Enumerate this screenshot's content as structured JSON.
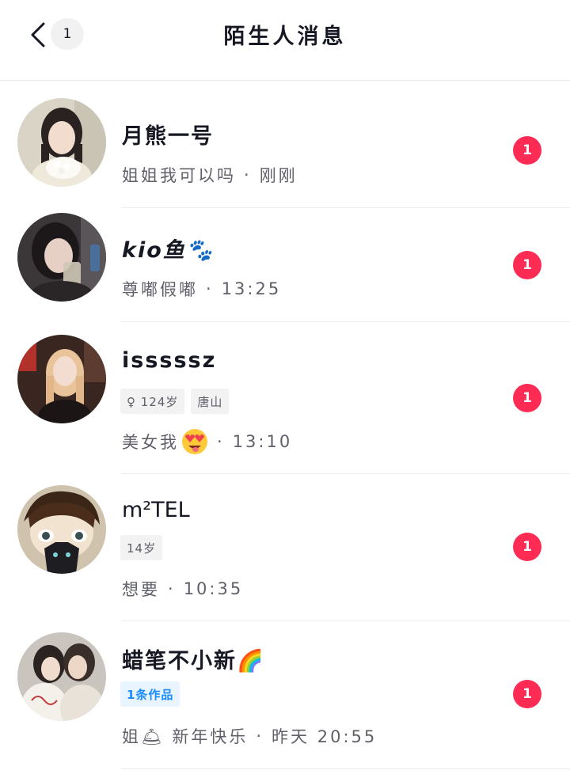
{
  "header": {
    "title": "陌生人消息",
    "unread_count": "1"
  },
  "messages": [
    {
      "name": "月熊一号",
      "preview": "姐姐我可以吗",
      "time": "刚刚",
      "badge": "1"
    },
    {
      "name": "kio鱼🐾",
      "preview": "尊嘟假嘟",
      "time": "13:25",
      "badge": "1"
    },
    {
      "name": "isssssz",
      "tags": [
        "♀ 124岁",
        "唐山"
      ],
      "preview": "美女我",
      "time": "13:10",
      "badge": "1"
    },
    {
      "name": "m²TEL",
      "tags": [
        "14岁"
      ],
      "preview": "想要",
      "time": "10:35",
      "badge": "1"
    },
    {
      "name": "蜡笔不小新🌈",
      "tags": [
        "1条作品"
      ],
      "preview": "姐🛎 新年快乐",
      "time": "昨天 20:55",
      "badge": "1"
    }
  ],
  "separator": "·",
  "colors": {
    "badge": "#fe2c55",
    "accent_blue": "#1a8cff",
    "text_primary": "#161823",
    "text_secondary": "#5f6069"
  }
}
